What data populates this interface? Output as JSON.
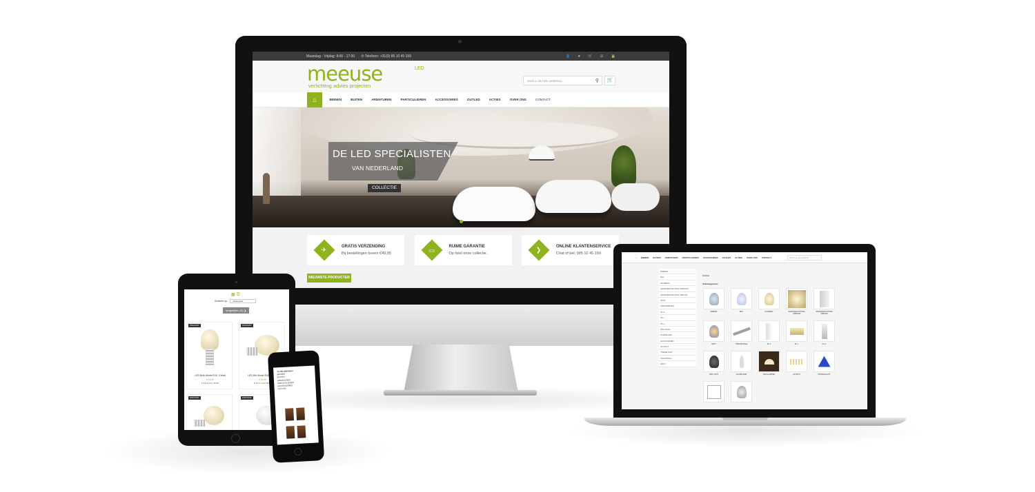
{
  "desktop": {
    "topbar": {
      "hours": "Maandag - Vrijdag: 8:00 - 17:00",
      "phone": "Telefoon: +31(0) 85 10 45 159",
      "icons": [
        "user-icon",
        "heart-icon",
        "cart-icon",
        "checkout-icon",
        "lock-icon"
      ]
    },
    "logo": {
      "word": "meeuse",
      "suffix": "LED",
      "tagline": "verlichting advies projecten"
    },
    "search": {
      "placeholder": "Zoek in de hele webshop..."
    },
    "nav": [
      "BINNEN",
      "BUITEN",
      "ARMATUREN",
      "PARTICULIEREN",
      "ACCESSOIRES",
      "OUTLED",
      "ACTIES",
      "OVER ONS",
      "CONTACT"
    ],
    "hero": {
      "title": "DE LED SPECIALISTEN",
      "subtitle": "VAN NEDERLAND",
      "button": "COLLECTIE"
    },
    "features": [
      {
        "icon": "plane-icon",
        "title": "GRATIS VERZENDING",
        "text": "Bij bestellingen boven €49,95"
      },
      {
        "icon": "laptop-icon",
        "title": "RUIME GARANTIE",
        "text": "Op heel onze collectie."
      },
      {
        "icon": "chat-icon",
        "title": "ONLINE KLANTENSERVICE",
        "text": "Chat of bel: 085 10 45 159"
      }
    ],
    "new_products_button": "NIEUWSTE PRODUCTEN",
    "colors": {
      "accent": "#8fb31d",
      "topbar": "#3c3c3c"
    }
  },
  "laptop": {
    "nav": [
      "BINNEN",
      "BUITEN",
      "ARMATUREN",
      "PARTICULIEREN",
      "ACCESSOIRES",
      "OUTLED",
      "ACTIES",
      "OVER ONS",
      "CONTACT"
    ],
    "search_placeholder": "Zoek in de hele webshop...",
    "sidebar": [
      "DIMBAR",
      "BOL",
      "FILAMENT",
      "WANDVERLICHTING OPBOUW",
      "WANDVERLICHTING INBOUW",
      "SPOT",
      "TWIN/SPIRALE",
      "PL-S",
      "PL-L",
      "PL-C",
      "PAR LIGHT",
      "KAARSLAMP",
      "HANGLAMPEN",
      "G9 SPOT",
      "TREDELIGHT",
      "PLAFONDLA",
      "GR10"
    ],
    "breadcrumb": "WAKEL",
    "heading": "Subcategorieën",
    "products": [
      "DIMBAR",
      "BOL",
      "FILAMENT",
      "WANDVERLICHTING OPBOUW",
      "WANDVERLICHTING INBOUW",
      "SPOT",
      "TWIN/SPIRALE",
      "PL-S",
      "PL-L",
      "PL-C",
      "PAR LIGHT",
      "KAARSLAMP",
      "HANGLAMPEN",
      "G9 SPOT",
      "PROFIELLIGHT"
    ]
  },
  "tablet": {
    "sort_label": "Sorteren op",
    "sort_value": "Relevantie",
    "compare_button": "Vergelijken (0)",
    "cards": [
      {
        "badge": "DISCOUNT",
        "name": "LED Bulb Model E40, 3 Watt",
        "price": "€ 16,95",
        "vat": "€ 13,31 excl. BTW"
      },
      {
        "badge": "DISCOUNT",
        "name": "LED Bol Model E40, 3 Watt",
        "price": "€ 15,95",
        "vat": "€ 13,17 excl. BTW"
      },
      {
        "badge": "DISCOUNT",
        "name": "",
        "price": "",
        "vat": ""
      },
      {
        "badge": "DISCOUNT",
        "name": "",
        "price": "",
        "vat": ""
      }
    ]
  },
  "phone": {
    "menu": [
      "Te rillo Winkelen",
      "BINNEN",
      "BUITEN",
      "ARMATUREN",
      "PARTICULIEREN",
      "ACCESSOIRES",
      "OUTLED"
    ]
  }
}
